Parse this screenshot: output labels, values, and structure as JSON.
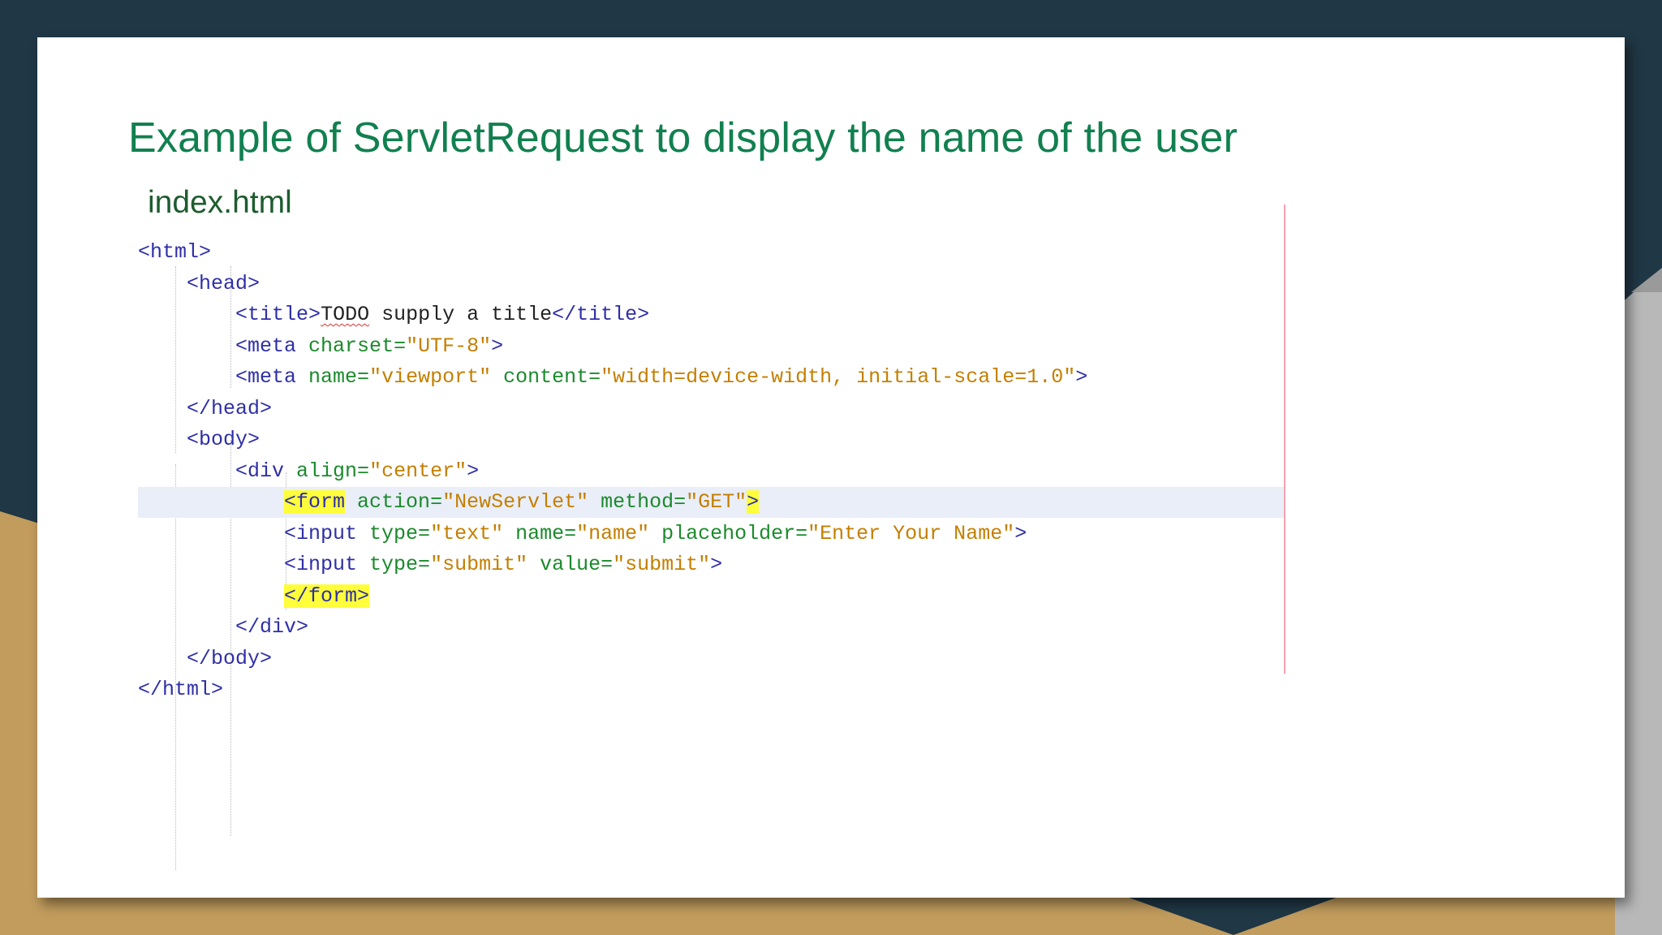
{
  "slide": {
    "title": "Example of ServletRequest to display the name of the user",
    "file_label": "index.html"
  },
  "code": {
    "l1": {
      "tag": "<html>"
    },
    "l2": {
      "tag": "<head>"
    },
    "l3": {
      "open": "<title>",
      "text_a": "TODO",
      "text_b": " supply a title",
      "close": "</title>"
    },
    "l4": {
      "open": "<meta",
      "attr1": " charset=",
      "val1": "\"UTF-8\"",
      "close": ">"
    },
    "l5": {
      "open": "<meta",
      "attr1": " name=",
      "val1": "\"viewport\"",
      "attr2": " content=",
      "val2": "\"width=device-width, initial-scale=1.0\"",
      "close": ">"
    },
    "l6": {
      "tag": "</head>"
    },
    "l7": {
      "tag": "<body>"
    },
    "l8": {
      "open": "<div",
      "attr1": " align=",
      "val1": "\"center\"",
      "close": ">"
    },
    "l9": {
      "open": "<form",
      "attr1": " action=",
      "val1": "\"NewServlet\"",
      "attr2": " method=",
      "val2": "\"GET\"",
      "close": ">"
    },
    "l10": {
      "open": "<input",
      "attr1": " type=",
      "val1": "\"text\"",
      "attr2": " name=",
      "val2": "\"name\"",
      "attr3": " placeholder=",
      "val3": "\"Enter Your Name\"",
      "close": ">"
    },
    "l11": {
      "open": "<input",
      "attr1": " type=",
      "val1": "\"submit\"",
      "attr2": " value=",
      "val2": "\"submit\"",
      "close": ">"
    },
    "l12": {
      "tag": "</form>"
    },
    "l13": {
      "tag": "</div>"
    },
    "l14": {
      "tag": "</body>"
    },
    "l15": {
      "tag": "</html>"
    }
  },
  "colors": {
    "title": "#11804f",
    "tag": "#2f2fa8",
    "attribute": "#1b8a2c",
    "value": "#c47f00",
    "highlight": "#fffe3a"
  }
}
